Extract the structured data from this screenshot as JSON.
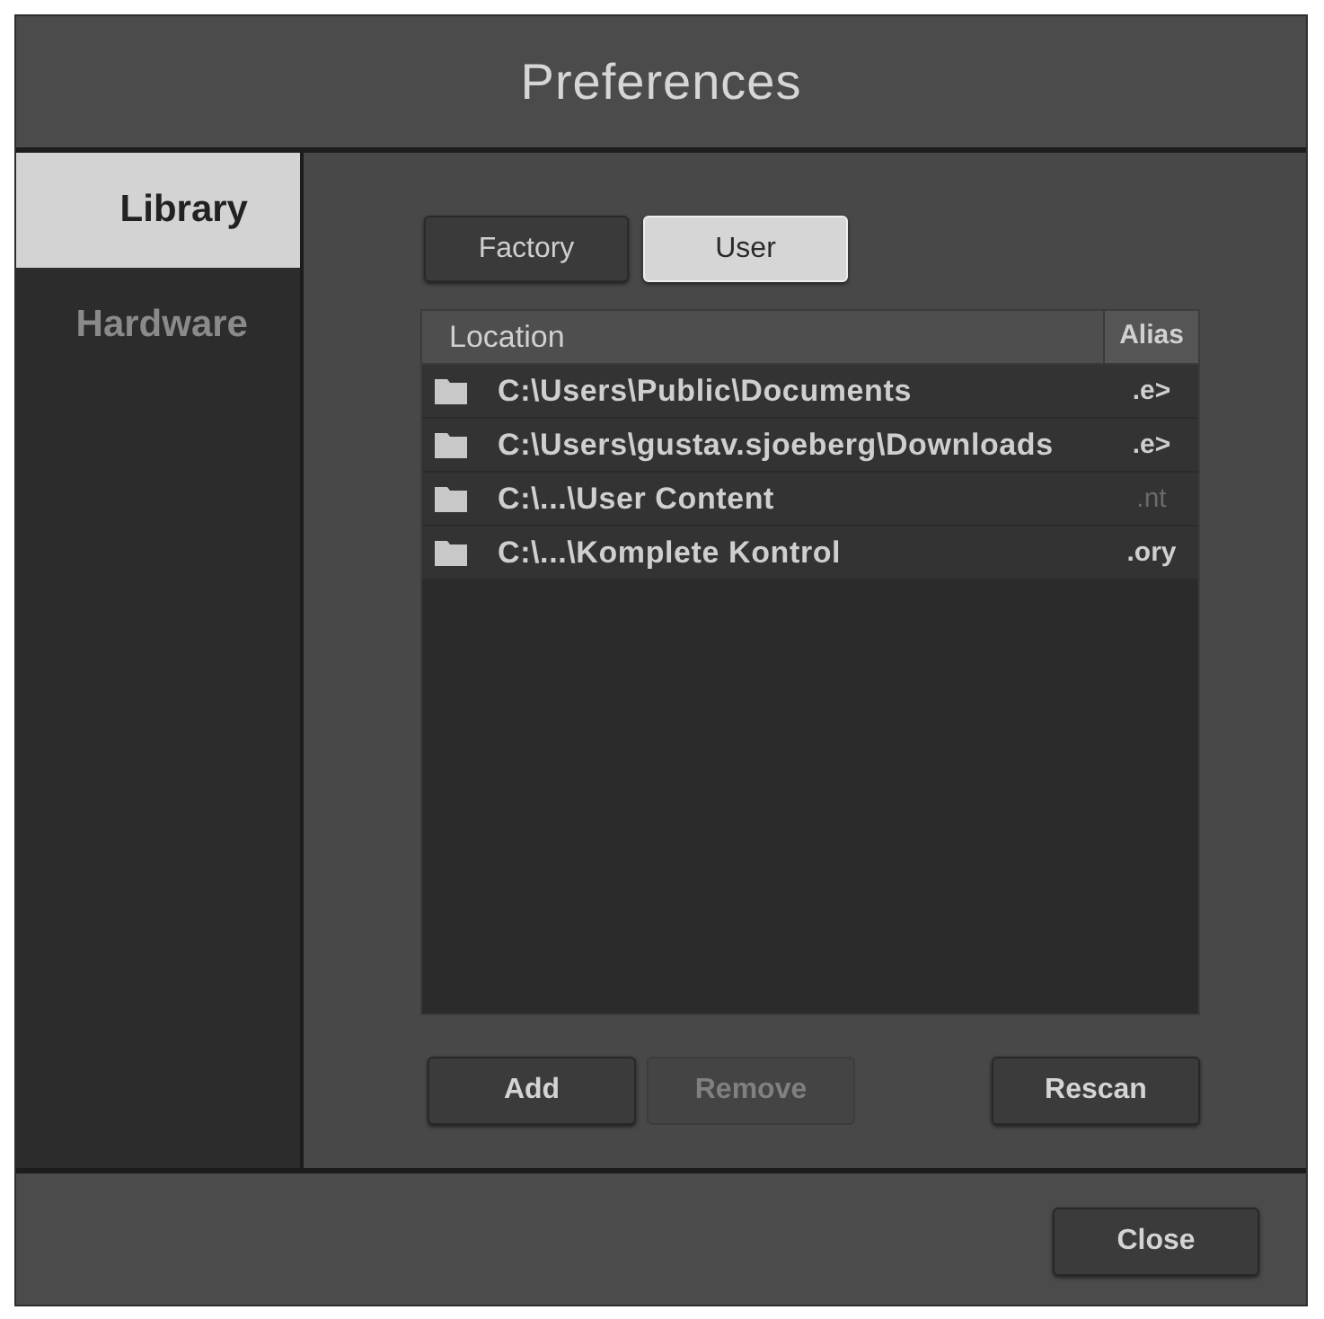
{
  "window": {
    "title": "Preferences"
  },
  "sidebar": {
    "items": [
      {
        "label": "Library",
        "selected": true
      },
      {
        "label": "Hardware",
        "selected": false
      }
    ]
  },
  "source_tabs": [
    {
      "label": "Factory",
      "selected": false
    },
    {
      "label": "User",
      "selected": true
    }
  ],
  "table": {
    "columns": [
      "Location",
      "Alias"
    ],
    "rows": [
      {
        "location": "C:\\Users\\Public\\Documents",
        "alias": ".e>",
        "alias_dimmed": false
      },
      {
        "location": "C:\\Users\\gustav.sjoeberg\\Downloads",
        "alias": ".e>",
        "alias_dimmed": false
      },
      {
        "location": "C:\\...\\User Content",
        "alias": ".nt",
        "alias_dimmed": true
      },
      {
        "location": "C:\\...\\Komplete Kontrol",
        "alias": ".ory",
        "alias_dimmed": false
      }
    ]
  },
  "actions": {
    "left": [
      {
        "label": "Add",
        "disabled": false
      },
      {
        "label": "Remove",
        "disabled": true
      }
    ],
    "right": [
      {
        "label": "Rescan",
        "disabled": false
      }
    ]
  },
  "footer": {
    "buttons": [
      "Close"
    ]
  }
}
